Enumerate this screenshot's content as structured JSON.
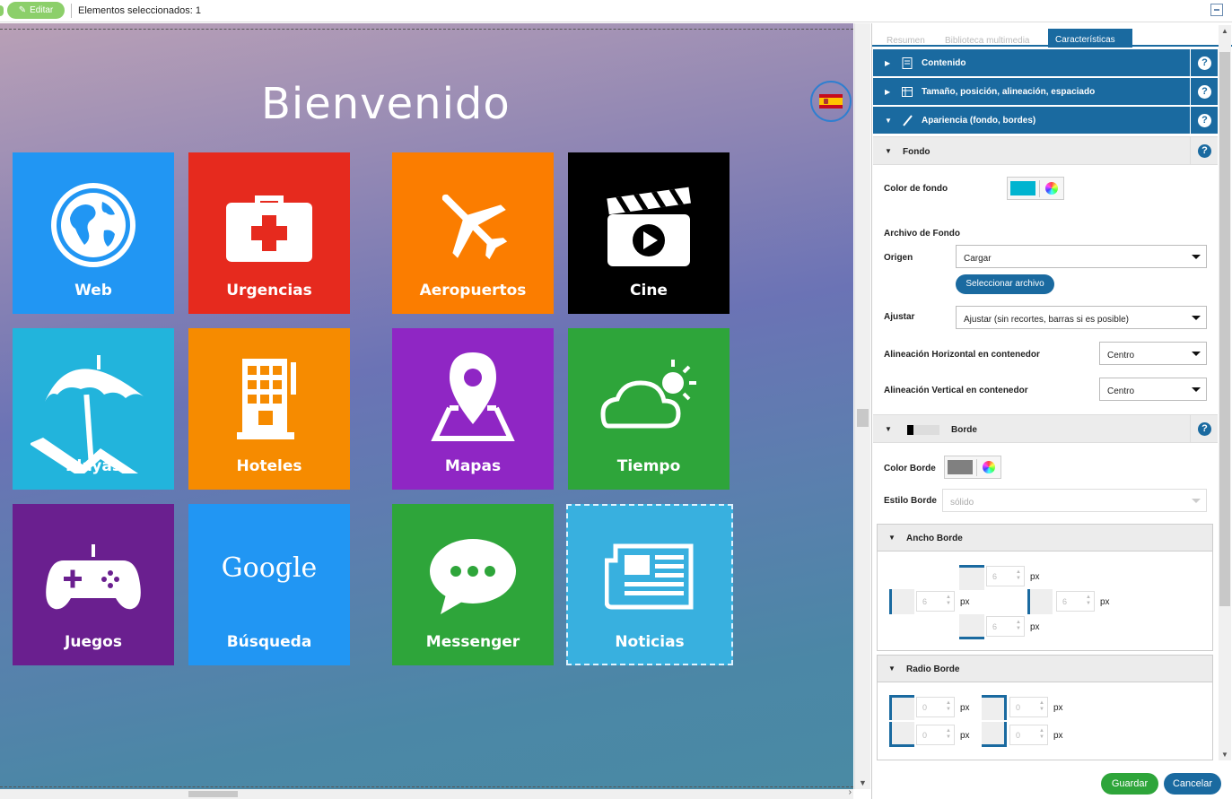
{
  "topbar": {
    "edit_label": "Editar",
    "selection_text": "Elementos seleccionados: 1"
  },
  "canvas": {
    "title": "Bienvenido",
    "tiles": [
      {
        "label": "Web",
        "color": "#2196f3",
        "icon": "globe-icon"
      },
      {
        "label": "Urgencias",
        "color": "#e62a1e",
        "icon": "first-aid-icon"
      },
      {
        "label": "Aeropuertos",
        "color": "#fb7d00",
        "icon": "airplane-icon"
      },
      {
        "label": "Cine",
        "color": "#000000",
        "icon": "clapperboard-icon"
      },
      {
        "label": "Playas",
        "color": "#22b4dc",
        "icon": "beach-umbrella-icon"
      },
      {
        "label": "Hoteles",
        "color": "#f68b00",
        "icon": "hotel-icon"
      },
      {
        "label": "Mapas",
        "color": "#8f26c4",
        "icon": "map-pin-icon"
      },
      {
        "label": "Tiempo",
        "color": "#2ea53a",
        "icon": "weather-icon"
      },
      {
        "label": "Juegos",
        "color": "#6a1f8f",
        "icon": "gamepad-icon"
      },
      {
        "label": "Búsqueda",
        "color": "#2196f3",
        "icon": "google-logo",
        "logo_text": "Google"
      },
      {
        "label": "Messenger",
        "color": "#2ea53a",
        "icon": "chat-bubble-icon"
      },
      {
        "label": "Noticias",
        "color": "#38b0df",
        "icon": "newspaper-icon"
      }
    ]
  },
  "panel": {
    "tabs": [
      "Resumen",
      "Biblioteca multimedia",
      "Características"
    ],
    "active_tab": "Características",
    "sections": {
      "contenido": "Contenido",
      "tamano": "Tamaño, posición, alineación, espaciado",
      "apariencia": "Apariencia (fondo, bordes)"
    },
    "fondo": {
      "title": "Fondo",
      "color_label": "Color de fondo",
      "color": "#00b4d0",
      "archivo_label": "Archivo de Fondo",
      "origen_label": "Origen",
      "origen_value": "Cargar",
      "select_file": "Seleccionar archivo",
      "ajustar_label": "Ajustar",
      "ajustar_value": "Ajustar (sin recortes, barras si es posible)",
      "h_align_label": "Alineación Horizontal en contenedor",
      "h_align_value": "Centro",
      "v_align_label": "Alineación Vertical en contenedor",
      "v_align_value": "Centro"
    },
    "borde": {
      "title": "Borde",
      "color_label": "Color Borde",
      "color": "#808080",
      "estilo_label": "Estilo Borde",
      "estilo_value": "sólido",
      "ancho_title": "Ancho Borde",
      "ancho_top": "6",
      "ancho_left": "6",
      "ancho_right": "6",
      "ancho_bottom": "6",
      "radio_title": "Radio Borde",
      "radio_tl": "0",
      "radio_tr": "0",
      "radio_bl": "0",
      "radio_br": "0",
      "unit": "px"
    },
    "help": "?",
    "save": "Guardar",
    "cancel": "Cancelar"
  }
}
